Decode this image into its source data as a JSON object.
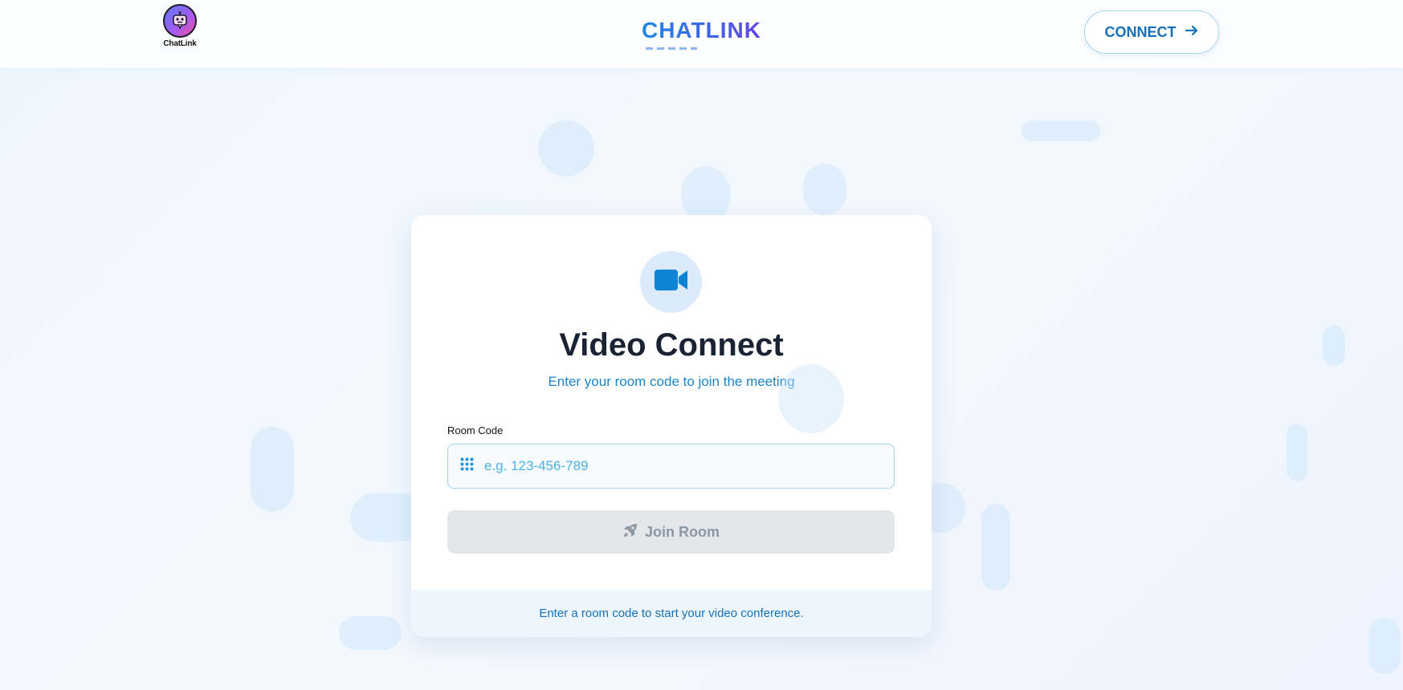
{
  "header": {
    "logo_text": "ChatLink",
    "brand": "CHATLINK",
    "connect_label": "CONNECT"
  },
  "card": {
    "title": "Video Connect",
    "subtitle": "Enter your room code to join the meeting",
    "room_code_label": "Room Code",
    "room_code_value": "",
    "room_code_placeholder": "e.g. 123-456-789",
    "join_label": "Join Room",
    "join_disabled": true,
    "footer_text": "Enter a room code to start your video conference."
  },
  "icons": {
    "logo": "robot-chat-icon",
    "connect": "arrow-right-icon",
    "camera": "video-camera-icon",
    "input": "keypad-icon",
    "join": "rocket-icon"
  },
  "colors": {
    "accent": "#1c84c6",
    "brand_start": "#1e88e5",
    "brand_end": "#6a44e8",
    "title": "#1a2333",
    "disabled_bg": "#e4e6ea",
    "disabled_text": "#8d96a4"
  }
}
